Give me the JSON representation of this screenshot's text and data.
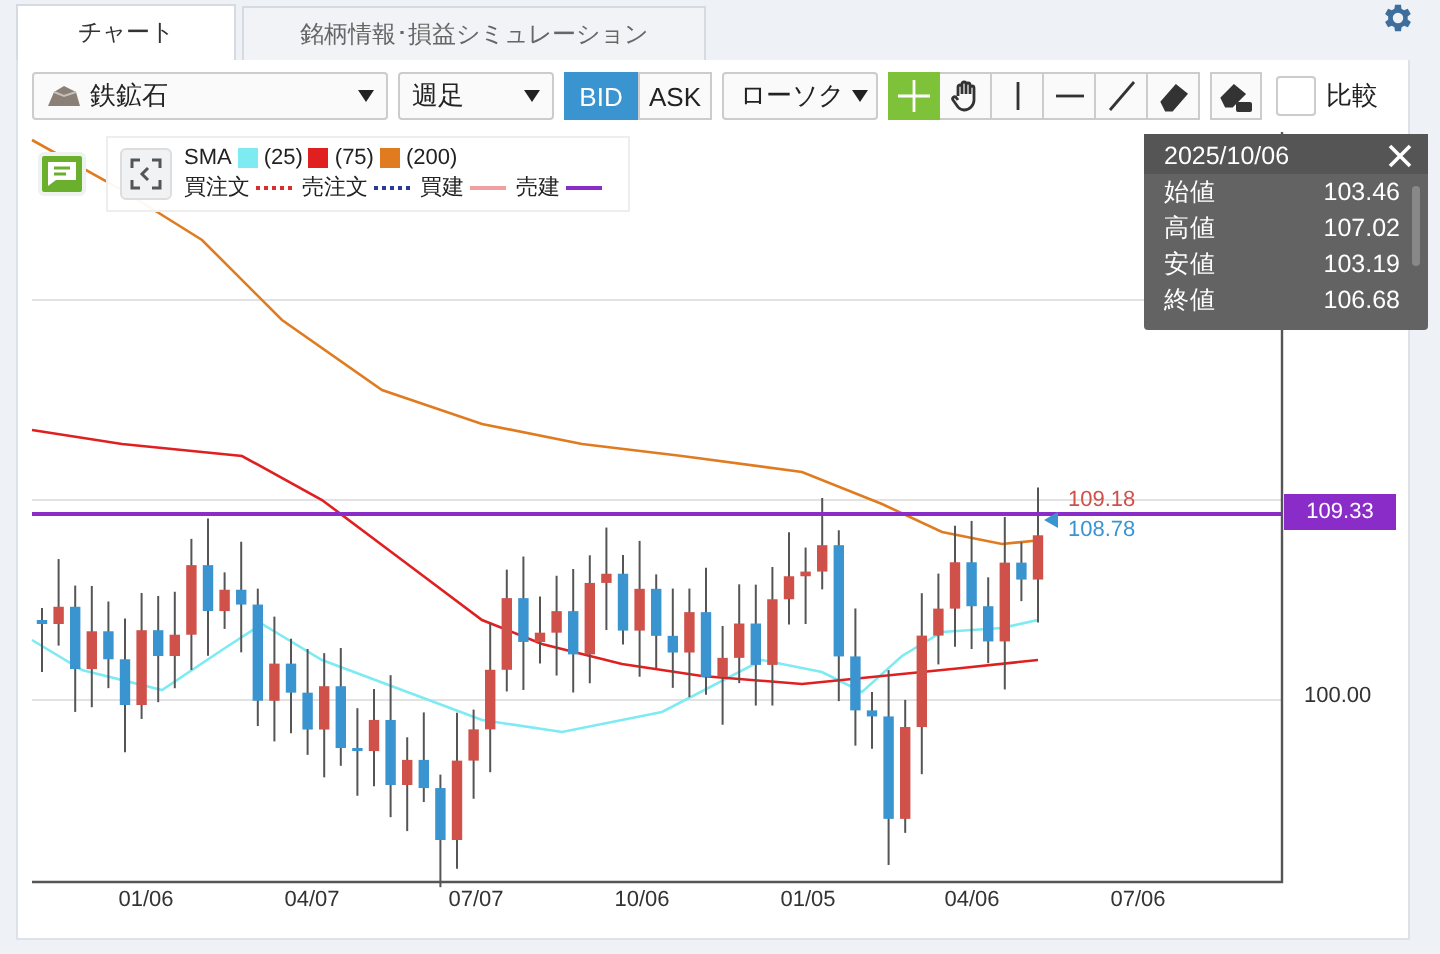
{
  "tabs": [
    {
      "label": "チャート",
      "selected": true
    },
    {
      "label": "銘柄情報･損益シミュレーション",
      "selected": false
    }
  ],
  "toolbar": {
    "symbol": "鉄鉱石",
    "period": "週足",
    "price_sides": [
      {
        "label": "BID",
        "selected": true
      },
      {
        "label": "ASK",
        "selected": false
      }
    ],
    "chart_type": "ローソク",
    "tools": [
      {
        "kind": "crosshair",
        "selected": true
      },
      {
        "kind": "hand",
        "selected": false
      },
      {
        "kind": "vertical",
        "selected": false
      },
      {
        "kind": "horizontal",
        "selected": false
      },
      {
        "kind": "trend",
        "selected": false
      },
      {
        "kind": "eraser",
        "selected": false
      },
      {
        "kind": "eraseall",
        "selected": false
      }
    ],
    "compare": {
      "label": "比較",
      "checked": false
    }
  },
  "legend": {
    "indicator": "SMA",
    "periods": [
      {
        "label": "(25)",
        "color": "#7eeaf2"
      },
      {
        "label": "(75)",
        "color": "#e02020"
      },
      {
        "label": "(200)",
        "color": "#e07b20"
      }
    ],
    "lines": [
      {
        "label": "買注文",
        "color": "#d83030",
        "kind": "dotted"
      },
      {
        "label": "売注文",
        "color": "#2a3a9a",
        "kind": "dotted"
      },
      {
        "label": "買建",
        "color": "#f0a0a0",
        "kind": "solid"
      },
      {
        "label": "売建",
        "color": "#8a2cc8",
        "kind": "solid"
      }
    ]
  },
  "chart": {
    "price_axis": [
      "100.00"
    ],
    "current_price": "109.33",
    "bid_label": "109.18",
    "ask_label": "108.78",
    "x_axis": [
      "01/06",
      "04/07",
      "07/07",
      "10/06",
      "01/05",
      "04/06",
      "07/06"
    ]
  },
  "tooltip": {
    "date": "2025/10/06",
    "rows": [
      {
        "label": "始値",
        "value": "103.46"
      },
      {
        "label": "高値",
        "value": "107.02"
      },
      {
        "label": "安値",
        "value": "103.19"
      },
      {
        "label": "終値",
        "value": "106.68"
      }
    ]
  }
}
